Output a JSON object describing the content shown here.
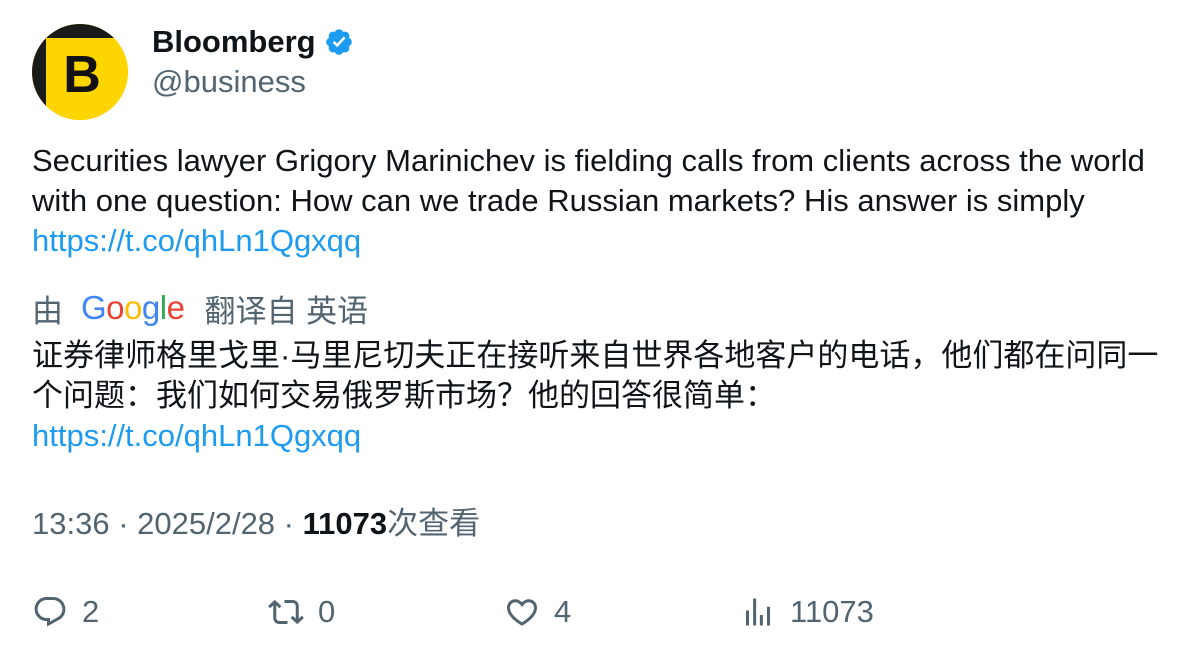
{
  "author": {
    "display_name": "Bloomberg",
    "handle": "@business",
    "verified": true,
    "avatar_letter": "B",
    "avatar_color": "#ffd500"
  },
  "tweet": {
    "text": "Securities lawyer Grigory Marinichev is fielding calls from clients across the world with one question: How can we trade Russian markets? His answer is simply ",
    "link": "https://t.co/qhLn1Qgxqq"
  },
  "translation": {
    "prefix": "由",
    "provider_letters": [
      "G",
      "o",
      "o",
      "g",
      "l",
      "e"
    ],
    "provider_colors": [
      "#4285f4",
      "#ea4335",
      "#fbbc05",
      "#4285f4",
      "#34a853",
      "#ea4335"
    ],
    "suffix": "翻译自 英语",
    "text": "证券律师格里戈里·马里尼切夫正在接听来自世界各地客户的电话，他们都在问同一个问题：我们如何交易俄罗斯市场？他的回答很简单：",
    "link": "https://t.co/qhLn1Qgxqq"
  },
  "meta": {
    "time": "13:36",
    "separator": " · ",
    "date": "2025/2/28",
    "views_count": "11073",
    "views_label": "次查看"
  },
  "actions": {
    "replies": "2",
    "retweets": "0",
    "likes": "4",
    "views": "11073"
  },
  "colors": {
    "link": "#1d9bf0",
    "secondary_text": "#536471",
    "primary_text": "#0f1419",
    "verified_badge": "#1d9bf0"
  }
}
